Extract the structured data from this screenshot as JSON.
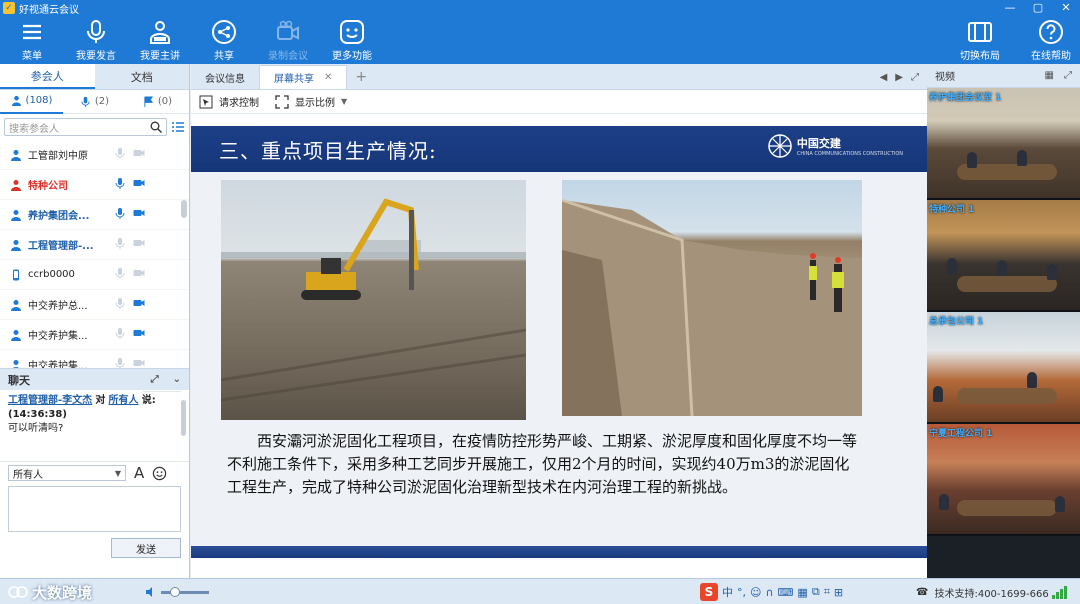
{
  "window": {
    "title": "好视通云会议",
    "controls": [
      "—",
      "▢",
      "✕"
    ]
  },
  "toolbar": {
    "left": [
      {
        "label": "菜单",
        "icon": "menu-icon"
      },
      {
        "label": "我要发言",
        "icon": "microphone-icon"
      },
      {
        "label": "我要主讲",
        "icon": "presenter-icon"
      },
      {
        "label": "共享",
        "icon": "share-icon"
      },
      {
        "label": "录制会议",
        "icon": "record-icon",
        "disabled": true
      },
      {
        "label": "更多功能",
        "icon": "more-features-icon"
      }
    ],
    "right": [
      {
        "label": "切换布局",
        "icon": "layout-icon"
      },
      {
        "label": "在线帮助",
        "icon": "help-icon"
      }
    ]
  },
  "left_panel": {
    "tabs": [
      "参会人",
      "文档"
    ],
    "active_tab": 0,
    "filters": [
      {
        "icon": "person-icon",
        "count": "(108)"
      },
      {
        "icon": "mic-icon",
        "count": "(2)"
      },
      {
        "icon": "flag-icon",
        "count": "(0)"
      }
    ],
    "search_placeholder": "搜索参会人",
    "participants": [
      {
        "name": "工管部刘中原",
        "style": "normal",
        "icon": "person-icon",
        "mic": "off",
        "cam": "off"
      },
      {
        "name": "特种公司",
        "style": "red",
        "icon": "person-icon",
        "mic": "on",
        "cam": "on"
      },
      {
        "name": "养护集团会...",
        "style": "bold",
        "icon": "person-icon",
        "mic": "on",
        "cam": "on"
      },
      {
        "name": "工程管理部-...",
        "style": "bold",
        "icon": "person-icon",
        "mic": "off",
        "cam": "off"
      },
      {
        "name": "ccrb0000",
        "style": "normal",
        "icon": "phone-icon",
        "mic": "off",
        "cam": "off"
      },
      {
        "name": "中交养护总...",
        "style": "normal",
        "icon": "person-icon",
        "mic": "off",
        "cam": "on"
      },
      {
        "name": "中交养护集...",
        "style": "normal",
        "icon": "person-icon",
        "mic": "off",
        "cam": "on"
      },
      {
        "name": "中交养护集...",
        "style": "normal",
        "icon": "person-icon",
        "mic": "off",
        "cam": "off"
      }
    ]
  },
  "chat": {
    "title": "聊天",
    "message": {
      "sender": "工程管理部-李文杰",
      "to_word": "对",
      "recipient": "所有人",
      "say": "说:",
      "time": "(14:36:38)",
      "text": "可以听清吗?"
    },
    "recipient_select": "所有人",
    "send_label": "发送"
  },
  "center": {
    "tabs": [
      {
        "label": "会议信息",
        "active": false
      },
      {
        "label": "屏幕共享",
        "active": true,
        "closable": true
      }
    ],
    "tools": [
      {
        "label": "请求控制",
        "icon": "remote-control-icon"
      },
      {
        "label": "显示比例",
        "icon": "scale-icon"
      }
    ],
    "slide": {
      "title": "三、重点项目生产情况:",
      "logo_text": "中国交建",
      "logo_sub": "CHINA COMMUNICATIONS CONSTRUCTION",
      "body": "西安灞河淤泥固化工程项目，在疫情防控形势严峻、工期紧、淤泥厚度和固化厚度不均一等不利施工条件下，采用多种工艺同步开展施工，仅用2个月的时间，实现约40万m3的淤泥固化工程生产，完成了特种公司淤泥固化治理新型技术在内河治理工程的新挑战。"
    }
  },
  "right_panel": {
    "title": "视频",
    "videos": [
      {
        "label": "养护集团会议室 1"
      },
      {
        "label": "特种公司 1"
      },
      {
        "label": "总承包公司 1"
      },
      {
        "label": "宁夏工程公司 1"
      }
    ]
  },
  "status": {
    "watermark": "大数跨境",
    "volume": 0.3,
    "ime": "中",
    "support": "技术支持:400-1699-666"
  },
  "colors": {
    "accent": "#1f7ad6",
    "slide_header": "#1c3f87",
    "warning": "#d8322b"
  }
}
